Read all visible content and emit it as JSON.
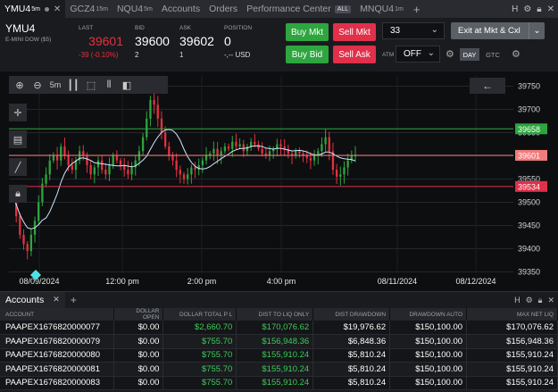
{
  "tabs": [
    {
      "label": "YMU4",
      "sup": "5m",
      "active": true
    },
    {
      "label": "GCZ4",
      "sup": "15m",
      "active": false
    },
    {
      "label": "NQU4",
      "sup": "5m",
      "active": false
    },
    {
      "label": "Accounts",
      "sup": "",
      "active": false
    },
    {
      "label": "Orders",
      "sup": "",
      "active": false
    },
    {
      "label": "Performance Center",
      "sup": "",
      "active": false
    },
    {
      "label": "MNQU4",
      "sup": "1m",
      "active": false
    }
  ],
  "all_badge": "ALL",
  "tab_icons": [
    "H",
    "gear-icon",
    "lock-icon",
    "close-icon"
  ],
  "quote": {
    "symbol": "YMU4",
    "description": "E-MINI DOW ($5)",
    "last_label": "LAST",
    "last": "39601",
    "change": "-39 (-0.10%)",
    "bid_label": "BID",
    "bid": "39600",
    "bid_size": "2",
    "ask_label": "ASK",
    "ask": "39602",
    "ask_size": "1",
    "position_label": "POSITION",
    "position": "0",
    "position_sub": "-,-- USD"
  },
  "buttons": {
    "buy_mkt": "Buy Mkt",
    "sell_mkt": "Sell Mkt",
    "buy_bid": "Buy Bid",
    "sell_ask": "Sell Ask",
    "quantity": "33",
    "exit": "Exit at Mkt & Cxl",
    "atm_label": "ATM",
    "atm_value": "OFF",
    "day": "DAY",
    "gtc": "GTC"
  },
  "chart_toolbar": [
    "zoom-in-icon",
    "zoom-out-icon",
    "5m",
    "bar-type-icon",
    "crosshair-select-icon",
    "indicator-icon",
    "template-icon"
  ],
  "chart_data": {
    "type": "candlestick",
    "y_ticks": [
      39350,
      39400,
      39450,
      39500,
      39550,
      39600,
      39650,
      39700,
      39750
    ],
    "ylim": [
      39328,
      39772
    ],
    "x_ticks": [
      "08/09/2024",
      "12:00 pm",
      "2:00 pm",
      "4:00 pm",
      "08/11/2024",
      "08/12/2024"
    ],
    "price_lines": [
      {
        "value": 39658,
        "label": "39658",
        "color": "#2ea53f"
      },
      {
        "value": 39601,
        "label": "39601",
        "color": "#f07c7c"
      },
      {
        "value": 39534,
        "label": "39534",
        "color": "#e0304a"
      }
    ],
    "ma_color": "#cfe8ff",
    "up_color": "#2ea53f",
    "down_color": "#e5313f"
  },
  "accounts": {
    "tab_label": "Accounts",
    "columns": [
      "ACCOUNT",
      "DOLLAR OPEN",
      "DOLLAR TOTAL P L",
      "DIST TO LIQ ONLY",
      "DIST DRAWDOWN",
      "DRAWDOWN AUTO",
      "MAX NET LIQ"
    ],
    "rows": [
      [
        "PAAPEX1676820000077",
        "$0.00",
        "$2,660.70",
        "$170,076.62",
        "$19,976.62",
        "$150,100.00",
        "$170,076.62"
      ],
      [
        "PAAPEX1676820000079",
        "$0.00",
        "$755.70",
        "$156,948.36",
        "$6,848.36",
        "$150,100.00",
        "$156,948.36"
      ],
      [
        "PAAPEX1676820000080",
        "$0.00",
        "$755.70",
        "$155,910.24",
        "$5,810.24",
        "$150,100.00",
        "$155,910.24"
      ],
      [
        "PAAPEX1676820000081",
        "$0.00",
        "$755.70",
        "$155,910.24",
        "$5,810.24",
        "$150,100.00",
        "$155,910.24"
      ],
      [
        "PAAPEX1676820000083",
        "$0.00",
        "$755.70",
        "$155,910.24",
        "$5,810.24",
        "$150,100.00",
        "$155,910.24"
      ]
    ]
  }
}
